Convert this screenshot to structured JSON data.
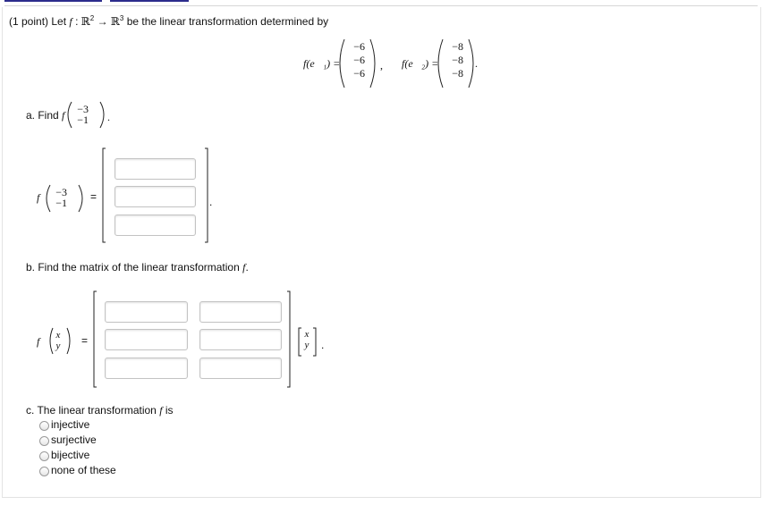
{
  "problem": {
    "points": "(1 point)",
    "lead_in": "Let",
    "f": "f",
    "colon": ":",
    "domain": "ℝ",
    "domain_exp": "2",
    "arrow": "→",
    "codomain": "ℝ",
    "codomain_exp": "3",
    "statement_tail": "be the linear transformation determined by",
    "f_e1_label": "f(e⃗₁) =",
    "f_e1": [
      "−6",
      "−6",
      "−6"
    ],
    "comma": ",",
    "f_e2_label": "f(e⃗₂) =",
    "f_e2": [
      "−8",
      "−8",
      "−8"
    ],
    "period": "."
  },
  "part_a": {
    "prompt": "a. Find",
    "f": "f",
    "vector": [
      "−3",
      "−1"
    ],
    "period": ".",
    "lhs_f": "f",
    "equals": "=",
    "answers": [
      "",
      "",
      ""
    ]
  },
  "part_b": {
    "prompt": "b. Find the matrix of the linear transformation",
    "f": "f",
    "period": ".",
    "lhs_f": "f",
    "vars": [
      "x",
      "y"
    ],
    "equals": "=",
    "matrix": [
      [
        "",
        ""
      ],
      [
        "",
        ""
      ],
      [
        "",
        ""
      ]
    ]
  },
  "part_c": {
    "prompt": "c. The linear transformation",
    "f": "f",
    "is": "is",
    "options": [
      "injective",
      "surjective",
      "bijective",
      "none of these"
    ]
  }
}
